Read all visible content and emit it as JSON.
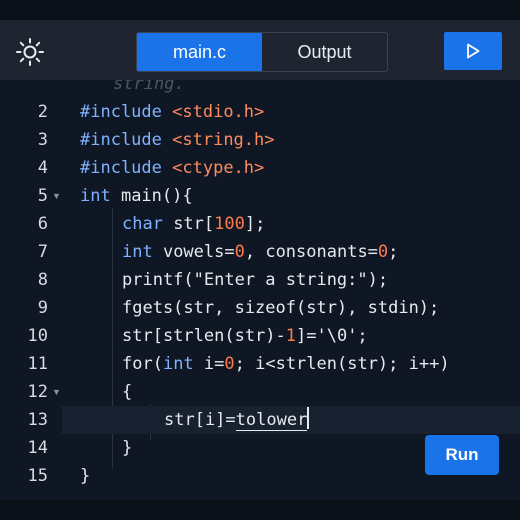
{
  "header": {
    "tabs": [
      {
        "label": "main.c",
        "active": true
      },
      {
        "label": "Output",
        "active": false
      }
    ],
    "theme_icon": "sun-icon",
    "run_icon": "play-icon"
  },
  "editor": {
    "ghost_text": "string.",
    "lines": [
      {
        "n": "2"
      },
      {
        "n": "3"
      },
      {
        "n": "4"
      },
      {
        "n": "5"
      },
      {
        "n": "6"
      },
      {
        "n": "7"
      },
      {
        "n": "8"
      },
      {
        "n": "9"
      },
      {
        "n": "10"
      },
      {
        "n": "11"
      },
      {
        "n": "12"
      },
      {
        "n": "13"
      },
      {
        "n": "14"
      },
      {
        "n": "15"
      }
    ],
    "tokens": {
      "l2_kw": "#include",
      "l2_hdr": "<stdio.h>",
      "l3_kw": "#include",
      "l3_hdr": "<string.h>",
      "l4_kw": "#include",
      "l4_hdr": "<ctype.h>",
      "l5_kw": "int",
      "l5_rest": " main(){",
      "l6_kw": "char",
      "l6_a": " str[",
      "l6_num": "100",
      "l6_b": "];",
      "l7_kw": "int",
      "l7_a": " vowels=",
      "l7_n1": "0",
      "l7_b": ", consonants=",
      "l7_n2": "0",
      "l7_c": ";",
      "l8": "printf(\"Enter a string:\");",
      "l9": "fgets(str, sizeof(str), stdin);",
      "l10_a": "str[strlen(str)-",
      "l10_num": "1",
      "l10_b": "]='\\0';",
      "l11_a": "for(",
      "l11_kw": "int",
      "l11_b": " i=",
      "l11_num": "0",
      "l11_c": "; i<strlen(str); i++)",
      "l12": "{",
      "l13_a": "str[i]=",
      "l13_word": "tolower",
      "l14": "}",
      "l15": "}"
    }
  },
  "run_button": {
    "label": "Run"
  },
  "colors": {
    "accent": "#1a73e8",
    "background": "#0f1724",
    "header": "#1e2531"
  }
}
